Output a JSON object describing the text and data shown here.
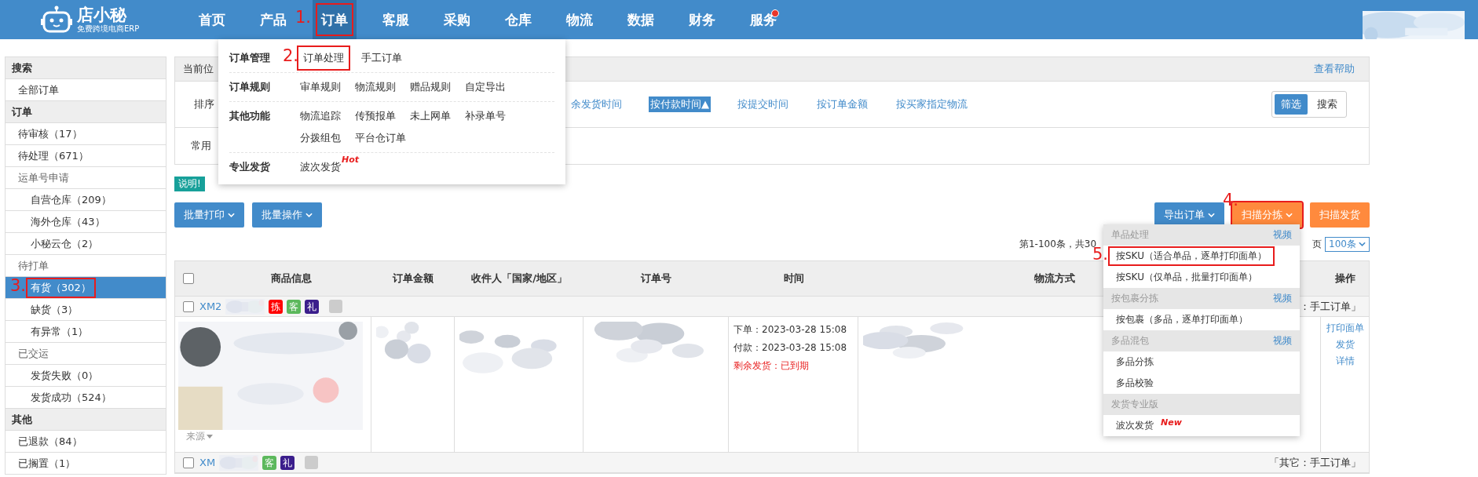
{
  "nav": {
    "logo": {
      "name": "店小秘",
      "tagline": "免费跨境电商ERP"
    },
    "items": [
      {
        "label": "首页",
        "selected": false,
        "dot": false
      },
      {
        "label": "产品",
        "selected": false,
        "dot": false
      },
      {
        "label": "订单",
        "selected": true,
        "dot": false,
        "annotation": "1."
      },
      {
        "label": "客服",
        "selected": false,
        "dot": false
      },
      {
        "label": "采购",
        "selected": false,
        "dot": false
      },
      {
        "label": "仓库",
        "selected": false,
        "dot": false
      },
      {
        "label": "物流",
        "selected": false,
        "dot": false
      },
      {
        "label": "数据",
        "selected": false,
        "dot": false
      },
      {
        "label": "财务",
        "selected": false,
        "dot": false
      },
      {
        "label": "服务",
        "selected": false,
        "dot": true
      }
    ]
  },
  "sidebar": {
    "sections": [
      {
        "title": "搜索",
        "items": [
          {
            "label": "全部订单",
            "selected": false
          }
        ]
      },
      {
        "title": "订单",
        "items": [
          {
            "label": "待审核（17）",
            "selected": false
          },
          {
            "label": "待处理（671）",
            "selected": false
          },
          {
            "label": "运单号申请",
            "selected": false,
            "children": [
              {
                "label": "自营仓库（209）",
                "selected": false
              },
              {
                "label": "海外仓库（43）",
                "selected": false
              },
              {
                "label": "小秘云仓（2）",
                "selected": false
              }
            ]
          },
          {
            "label": "待打单",
            "selected": false,
            "children": [
              {
                "label": "有货（302）",
                "selected": true,
                "annotation": "3."
              },
              {
                "label": "缺货（3）",
                "selected": false
              },
              {
                "label": "有异常（1）",
                "selected": false
              }
            ]
          },
          {
            "label": "已交运",
            "selected": false,
            "children": [
              {
                "label": "发货失败（0）",
                "selected": false
              },
              {
                "label": "发货成功（524）",
                "selected": false
              }
            ]
          }
        ]
      },
      {
        "title": "其他",
        "items": [
          {
            "label": "已退款（84）",
            "selected": false
          },
          {
            "label": "已搁置（1）",
            "selected": false
          }
        ]
      }
    ]
  },
  "breadcrumb": {
    "label": "当前位",
    "help": "查看帮助"
  },
  "sort": {
    "label": "排序",
    "options": [
      {
        "label": "余发货时间",
        "selected": false
      },
      {
        "label": "按付款时间▲",
        "selected": true
      },
      {
        "label": "按提交时间",
        "selected": false
      },
      {
        "label": "按订单金额",
        "selected": false
      },
      {
        "label": "按买家指定物流",
        "selected": false
      }
    ]
  },
  "view_toggle": [
    {
      "label": "筛选",
      "selected": true
    },
    {
      "label": "搜索",
      "selected": false
    }
  ],
  "filter_row": {
    "label": "常用"
  },
  "notice": "说明!",
  "left_buttons": [
    "批量打印",
    "批量操作"
  ],
  "right_buttons": [
    {
      "label": "导出订单",
      "kind": "primary",
      "caret": true
    },
    {
      "label": "扫描分拣",
      "kind": "warning",
      "caret": true,
      "annotation": "4."
    },
    {
      "label": "扫描发货",
      "kind": "warning",
      "caret": false
    }
  ],
  "pagination": {
    "summary": "第1-100条，共30",
    "suffix": "页",
    "page_size": "100条"
  },
  "table": {
    "header_checked": false,
    "columns": [
      "商品信息",
      "订单金额",
      "收件人「国家/地区」",
      "订单号",
      "时间",
      "物流方式",
      "操作"
    ],
    "orders": [
      {
        "id": "XM2",
        "checked": false,
        "tags": [
          {
            "label": "拣",
            "color": "#ff0000"
          },
          {
            "label": "客",
            "color": "#5cb85c"
          },
          {
            "label": "礼",
            "color": "#3b1e8c"
          }
        ],
        "note": "：手工订单」",
        "detail": {
          "source": "来源",
          "times": [
            {
              "label": "下单：2023-03-28 15:08",
              "kind": "normal"
            },
            {
              "label": "付款：2023-03-28 15:08",
              "kind": "normal"
            },
            {
              "label": "剩余发货：已到期",
              "kind": "alert"
            }
          ],
          "actions": [
            "打印面单",
            "发货",
            "详情"
          ]
        }
      },
      {
        "id": "XM",
        "checked": false,
        "tags": [
          {
            "label": "客",
            "color": "#5cb85c"
          },
          {
            "label": "礼",
            "color": "#3b1e8c"
          }
        ],
        "note": "「其它：手工订单」"
      }
    ]
  },
  "order_menu": {
    "rows": [
      {
        "title": "订单管理",
        "links": [
          {
            "label": "订单处理",
            "annotation": "2."
          },
          {
            "label": "手工订单"
          }
        ]
      },
      {
        "title": "订单规则",
        "links": [
          {
            "label": "审单规则"
          },
          {
            "label": "物流规则"
          },
          {
            "label": "赠品规则"
          },
          {
            "label": "自定导出"
          }
        ]
      },
      {
        "title": "其他功能",
        "links": [
          {
            "label": "物流追踪"
          },
          {
            "label": "传预报单"
          },
          {
            "label": "未上网单"
          },
          {
            "label": "补录单号"
          },
          {
            "label": "分拨组包"
          },
          {
            "label": "平台仓订单"
          }
        ]
      },
      {
        "title": "专业发货",
        "links": [
          {
            "label": "波次发货",
            "badge": "Hot"
          }
        ]
      }
    ]
  },
  "scan_menu": {
    "sections": [
      {
        "title": "单品处理",
        "video": "视频",
        "items": [
          {
            "label": "按SKU（适合单品，逐单打印面单）",
            "annotation": "5."
          },
          {
            "label": "按SKU（仅单品，批量打印面单）"
          }
        ]
      },
      {
        "title": "按包裹分拣",
        "video": "视频",
        "items": [
          {
            "label": "按包裹（多品，逐单打印面单）"
          }
        ]
      },
      {
        "title": "多品混包",
        "video": "视频",
        "items": [
          {
            "label": "多品分拣"
          },
          {
            "label": "多品校验"
          }
        ]
      },
      {
        "title": "发货专业版",
        "items": [
          {
            "label": "波次发货",
            "badge": "New"
          }
        ]
      }
    ]
  }
}
